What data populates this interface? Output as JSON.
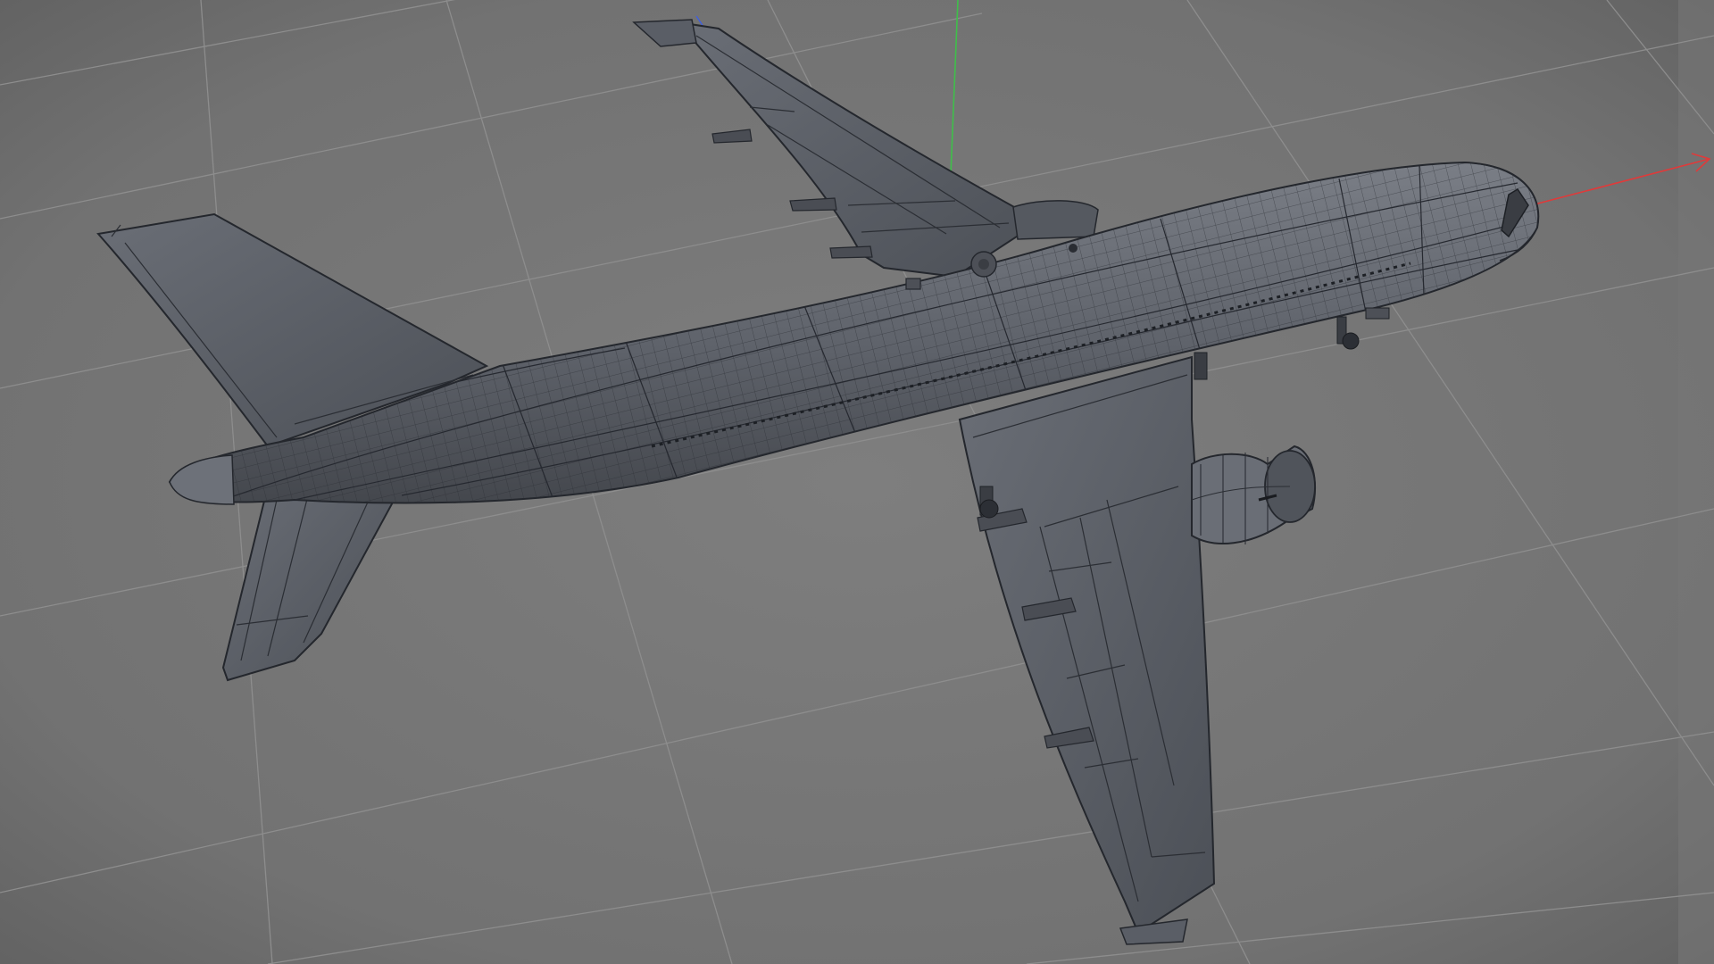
{
  "viewport": {
    "background": "#767676",
    "grid_color": "#8e8e8e",
    "model_fill": "#5c6068",
    "model_wire": "#24272d",
    "axis_x_color": "#e03a3a",
    "axis_y_color": "#3fbf4a",
    "axis_z_color": "#3f5fe0",
    "model_icon": "airplane-wireframe-icon"
  }
}
